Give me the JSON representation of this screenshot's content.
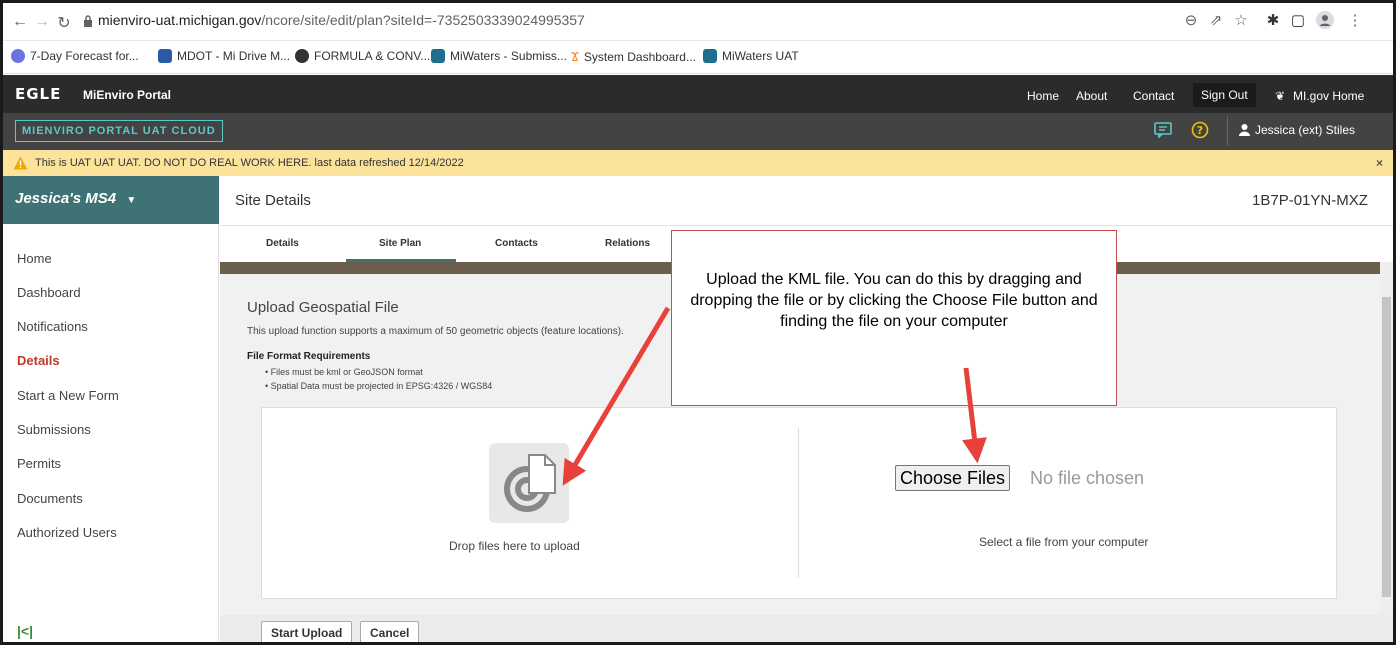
{
  "browser": {
    "url_host": "mienviro-uat.michigan.gov",
    "url_path": "/ncore/site/edit/plan?siteId=-7352503339024995357",
    "bookmarks": [
      {
        "label": "7-Day Forecast for...",
        "color": "#6b73e0"
      },
      {
        "label": "MDOT - Mi Drive M...",
        "color": "#2b5aa8"
      },
      {
        "label": "FORMULA & CONV...",
        "color": "#333333"
      },
      {
        "label": "MiWaters - Submiss...",
        "color": "#1f6e8f"
      },
      {
        "label": "System Dashboard...",
        "color": "#f58220"
      },
      {
        "label": "MiWaters UAT",
        "color": "#1f6e8f"
      }
    ]
  },
  "header": {
    "logo": "EGLE",
    "portal_name": "MiEnviro Portal",
    "nav": [
      "Home",
      "About",
      "Contact"
    ],
    "sign_out": "Sign Out",
    "migov": "MI.gov Home",
    "env_badge": "MIENVIRO PORTAL UAT CLOUD",
    "user_name": "Jessica (ext) Stiles"
  },
  "banner": {
    "text": "This is UAT UAT UAT. DO NOT DO REAL WORK HERE. last data refreshed 12/14/2022",
    "close": "×"
  },
  "sidebar": {
    "org": "Jessica's MS4",
    "items": [
      "Home",
      "Dashboard",
      "Notifications",
      "Details",
      "Start a New Form",
      "Submissions",
      "Permits",
      "Documents",
      "Authorized Users"
    ],
    "active": "Details",
    "collapse_glyph": "|<|"
  },
  "page": {
    "title": "Site Details",
    "site_id": "1B7P-01YN-MXZ",
    "tabs": [
      "Details",
      "Site Plan",
      "Contacts",
      "Relations"
    ],
    "active_tab": "Site Plan"
  },
  "upload": {
    "title": "Upload Geospatial File",
    "description": "This upload function supports a maximum of 50 geometric objects (feature locations).",
    "requirements_heading": "File Format Requirements",
    "requirements": [
      "Files must be kml or GeoJSON format",
      "Spatial Data must be projected in EPSG:4326 / WGS84"
    ],
    "drop_text": "Drop files here to upload",
    "choose_button": "Choose Files",
    "no_file": "No file chosen",
    "select_text": "Select a file from your computer",
    "start_button": "Start Upload",
    "cancel_button": "Cancel"
  },
  "annotation": {
    "callout_text": "Upload the KML file.  You can do this by dragging and dropping the file or by clicking the Choose File button and finding the file on your computer",
    "arrow_color": "#e8403a"
  },
  "colors": {
    "accent": "#3f7274",
    "active_nav": "#c0392b",
    "banner": "#fbe39b"
  }
}
